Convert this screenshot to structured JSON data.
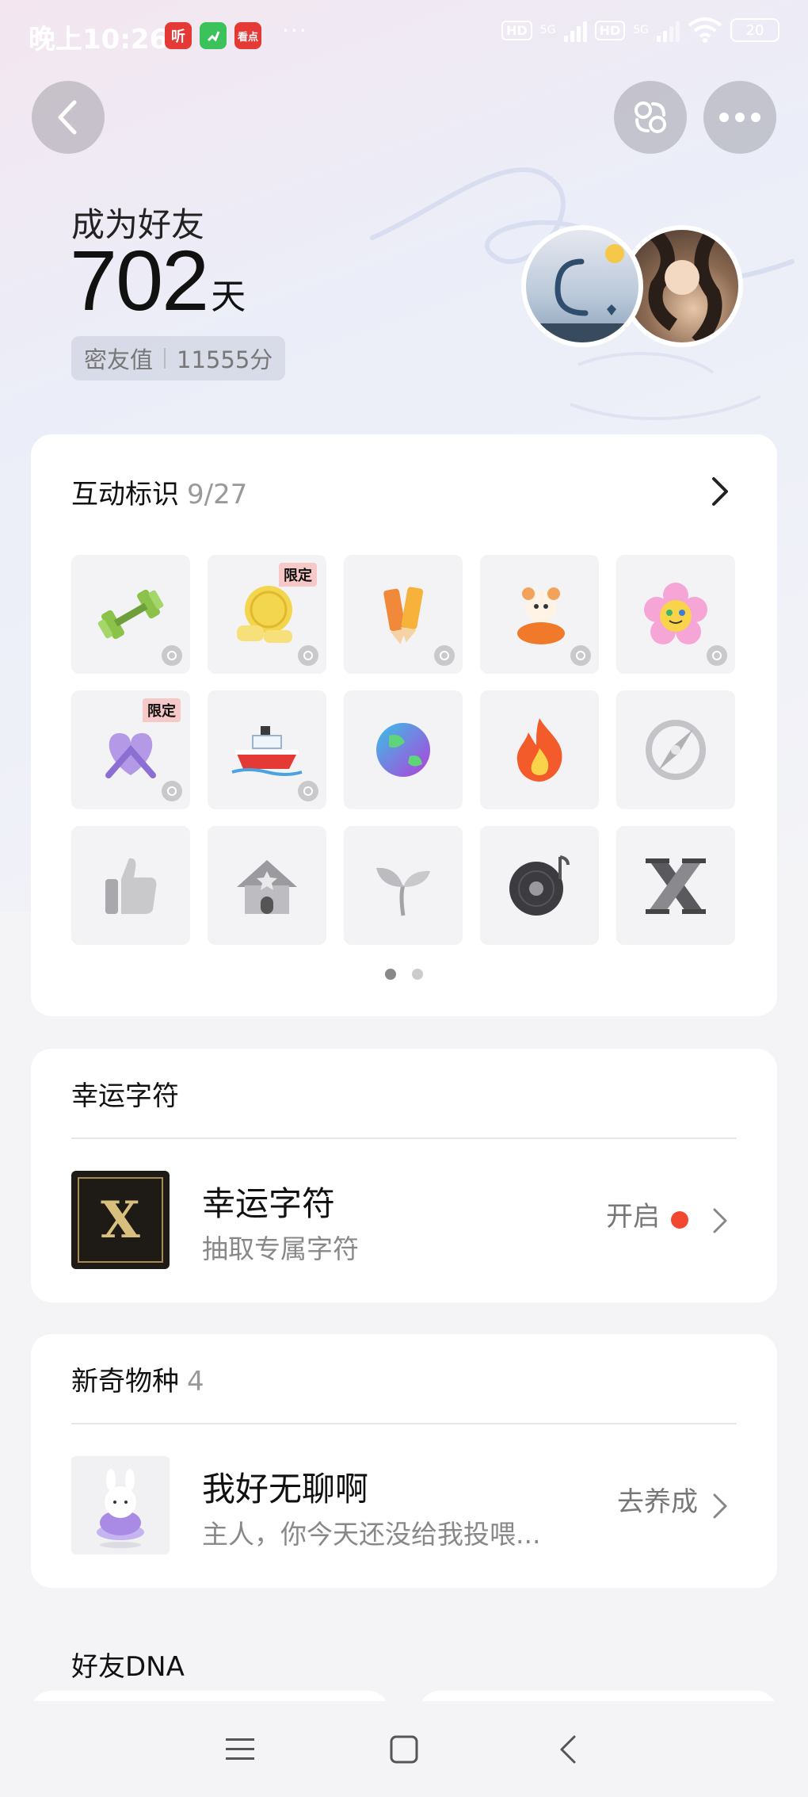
{
  "status_bar": {
    "time": "晚上10:26",
    "app_icons": [
      {
        "name": "listen-app-icon",
        "label": "听",
        "color": "#e53935"
      },
      {
        "name": "green-app-icon",
        "label": "",
        "color": "#3cc25a"
      },
      {
        "name": "news-app-icon",
        "label": "看点",
        "color": "#e53935"
      }
    ],
    "more": "···",
    "hd1": "HD",
    "hd2": "HD",
    "net1": "5G",
    "net2": "5G",
    "battery": "20"
  },
  "header": {
    "back_icon": "back-arrow-icon",
    "friend_icon": "friend-link-icon",
    "more_icon": "more-dots-icon"
  },
  "friendship": {
    "label": "成为好友",
    "days": "702",
    "days_unit": "天",
    "intimacy_label": "密友值",
    "intimacy_value": "11555分"
  },
  "badges_card": {
    "title": "互动标识",
    "count": "9/27",
    "limited_label": "限定",
    "badges": [
      {
        "name": "dumbbell-badge",
        "icon": "dumbbell",
        "lit": true,
        "limited": false,
        "medal": true
      },
      {
        "name": "cookie-badge",
        "icon": "cookie",
        "lit": true,
        "limited": true,
        "medal": true
      },
      {
        "name": "pencils-badge",
        "icon": "pencils",
        "lit": true,
        "limited": false,
        "medal": true
      },
      {
        "name": "cat-fish-badge",
        "icon": "cat-fish",
        "lit": true,
        "limited": false,
        "medal": true
      },
      {
        "name": "flower-smile-badge",
        "icon": "flower",
        "lit": true,
        "limited": false,
        "medal": true
      },
      {
        "name": "heart-bow-badge",
        "icon": "heart-bow",
        "lit": true,
        "limited": true,
        "medal": true
      },
      {
        "name": "ship-badge",
        "icon": "ship",
        "lit": true,
        "limited": false,
        "medal": true
      },
      {
        "name": "earth-badge",
        "icon": "earth",
        "lit": true,
        "limited": false,
        "medal": false
      },
      {
        "name": "fire-badge",
        "icon": "fire",
        "lit": true,
        "limited": false,
        "medal": false
      },
      {
        "name": "compass-badge",
        "icon": "compass",
        "lit": false,
        "limited": false,
        "medal": false
      },
      {
        "name": "thumbs-up-badge",
        "icon": "thumb",
        "lit": false,
        "limited": false,
        "medal": false
      },
      {
        "name": "house-star-badge",
        "icon": "house",
        "lit": false,
        "limited": false,
        "medal": false
      },
      {
        "name": "sprout-badge",
        "icon": "sprout",
        "lit": false,
        "limited": false,
        "medal": false
      },
      {
        "name": "vinyl-record-badge",
        "icon": "vinyl",
        "lit": false,
        "limited": false,
        "medal": false
      },
      {
        "name": "letter-x-badge",
        "icon": "x",
        "lit": false,
        "limited": false,
        "medal": false
      }
    ],
    "pages": 2,
    "current_page": 1
  },
  "lucky_card": {
    "section_title": "幸运字符",
    "item_title": "幸运字符",
    "item_sub": "抽取专属字符",
    "action": "开启",
    "thumb_letter": "X"
  },
  "species_card": {
    "section_title": "新奇物种",
    "count": "4",
    "item_title": "我好无聊啊",
    "item_sub": "主人，你今天还没给我投喂...",
    "action": "去养成"
  },
  "dna_section": {
    "title": "好友DNA"
  },
  "colors": {
    "accent_red": "#f2482f",
    "card_bg": "#ffffff",
    "page_bg": "#f4f4f7"
  }
}
